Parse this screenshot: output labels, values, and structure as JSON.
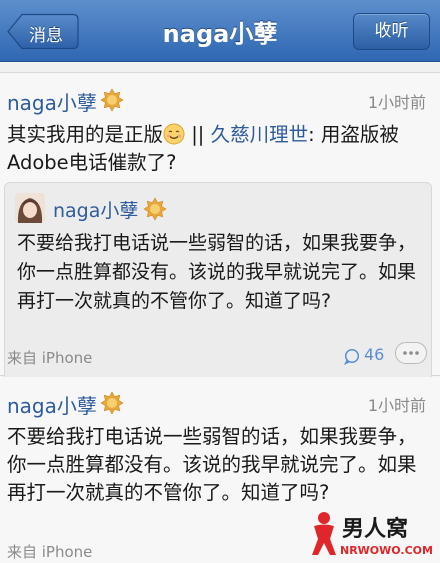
{
  "navbar": {
    "title": "naga小孽",
    "back_label": "消息",
    "right_label": "收听"
  },
  "posts": [
    {
      "author": "naga小孽",
      "time": "1小时前",
      "text_before": "其实我用的是正版",
      "emoji": "smile-emoji",
      "text_sep": " || ",
      "mention": "久慈川理世",
      "text_after": ": 用盗版被Adobe电话催款了?",
      "quoted": {
        "author": "naga小孽",
        "text": "不要给我打电话说一些弱智的话，如果我要争，你一点胜算都没有。该说的我早就说完了。如果再打一次就真的不管你了。知道了吗?"
      },
      "source": "来自 iPhone",
      "comment_count": "46"
    },
    {
      "author": "naga小孽",
      "time": "1小时前",
      "text": "不要给我打电话说一些弱智的话，如果我要争，你一点胜算都没有。该说的我早就说完了。如果再打一次就真的不管你了。知道了吗?",
      "source": "来自 iPhone"
    }
  ],
  "watermark": {
    "brand": "男人窝",
    "url": "NRWOWO.COM"
  },
  "colors": {
    "navbar": "#3b72bc",
    "link": "#2f5c9a",
    "badge": "#e8a73c",
    "watermark_red": "#e0262a"
  },
  "icons": [
    "back-arrow-icon",
    "verified-badge-icon",
    "smile-emoji-icon",
    "comment-icon",
    "more-icon",
    "avatar"
  ]
}
